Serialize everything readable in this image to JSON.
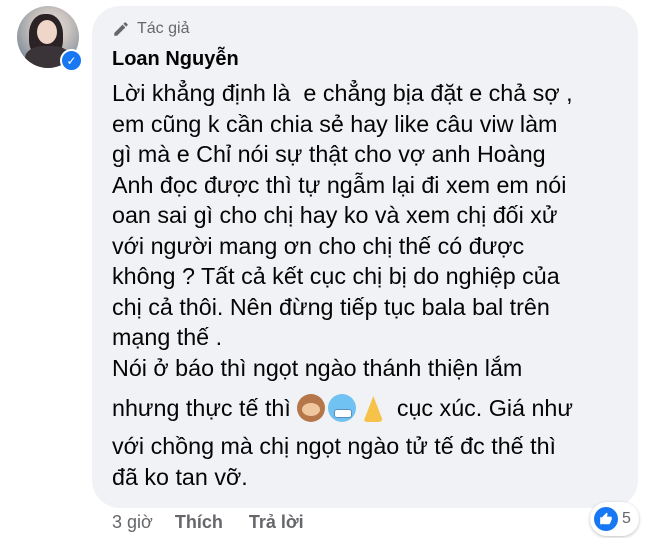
{
  "comment": {
    "badge_label": "Tác giả",
    "author_name": "Loan Nguyễn",
    "lines": [
      "Lời khẳng định là  e chẳng bịa đặt e chả sợ ,",
      "em cũng k cần chia sẻ hay like câu viw làm",
      "gì mà e Chỉ nói sự thật cho vợ anh Hoàng",
      "Anh đọc được thì tự ngẫm lại đi xem em nói",
      "oan sai gì cho chị hay ko và xem chị đối xử",
      "với người mang ơn cho chị thế có được",
      "không ? Tất cả kết cục chị bị do nghiệp của",
      "chị cả thôi. Nên đừng tiếp tục bala bal trên",
      "mạng thế .",
      "Nói ở báo thì ngọt ngào thánh thiện lắm"
    ],
    "emoji_line_before": "nhưng thực tế thì",
    "emojis": [
      "see-no-evil-monkey",
      "cold-face",
      "folded-hands"
    ],
    "emoji_line_after": " cục xúc. Giá như",
    "tail_lines": [
      "với chồng mà chị ngọt ngào tử tế đc thế thì",
      "đã ko tan vỡ."
    ]
  },
  "actions": {
    "time": "3 giờ",
    "like": "Thích",
    "reply": "Trả lời"
  },
  "reactions": {
    "type": "like",
    "count": "5"
  },
  "colors": {
    "bubble": "#f0f2f5",
    "text": "#050505",
    "secondary": "#65676b",
    "accent": "#1877f2"
  }
}
